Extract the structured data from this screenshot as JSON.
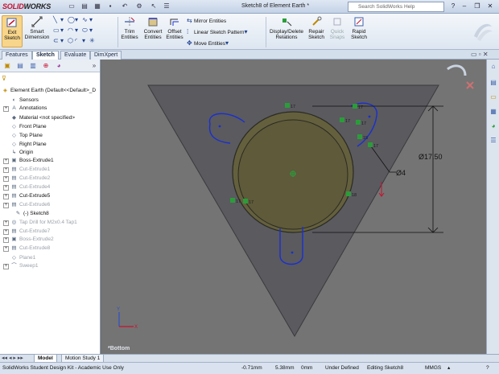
{
  "app": {
    "logo_solid": "SOLID",
    "logo_works": "WORKS",
    "document_title": "Sketch8 of Element Earth *",
    "search_placeholder": "Search SolidWorks Help"
  },
  "ribbon": {
    "exit_sketch": "Exit Sketch",
    "smart_dimension": "Smart Dimension",
    "trim_entities": "Trim Entities",
    "convert_entities": "Convert Entities",
    "offset_entities": "Offset Entities",
    "mirror_entities": "Mirror Entities",
    "linear_sketch_pattern": "Linear Sketch Pattern",
    "move_entities": "Move Entities",
    "display_delete_relations": "Display/Delete Relations",
    "repair_sketch": "Repair Sketch",
    "quick_snaps": "Quick Snaps",
    "rapid_sketch": "Rapid Sketch"
  },
  "tabs": [
    "Features",
    "Sketch",
    "Evaluate",
    "DimXpert"
  ],
  "active_tab": "Sketch",
  "tree": {
    "root": "Element Earth  (Default<<Default>_D",
    "items": [
      {
        "label": "Sensors",
        "icon": "sensor-icon",
        "expandable": false,
        "dim": false
      },
      {
        "label": "Annotations",
        "icon": "annotations-icon",
        "expandable": true,
        "dim": false
      },
      {
        "label": "Material <not specified>",
        "icon": "material-icon",
        "expandable": false,
        "dim": false
      },
      {
        "label": "Front Plane",
        "icon": "plane-icon",
        "expandable": false,
        "dim": false
      },
      {
        "label": "Top Plane",
        "icon": "plane-icon",
        "expandable": false,
        "dim": false
      },
      {
        "label": "Right Plane",
        "icon": "plane-icon",
        "expandable": false,
        "dim": false
      },
      {
        "label": "Origin",
        "icon": "origin-icon",
        "expandable": false,
        "dim": false
      },
      {
        "label": "Boss-Extrude1",
        "icon": "extrude-icon",
        "expandable": true,
        "dim": false
      },
      {
        "label": "Cut-Extrude1",
        "icon": "cut-extrude-icon",
        "expandable": true,
        "dim": true
      },
      {
        "label": "Cut-Extrude2",
        "icon": "cut-extrude-icon",
        "expandable": true,
        "dim": true
      },
      {
        "label": "Cut-Extrude4",
        "icon": "cut-extrude-icon",
        "expandable": true,
        "dim": true
      },
      {
        "label": "Cut-Extrude5",
        "icon": "cut-extrude-icon",
        "expandable": true,
        "dim": false
      },
      {
        "label": "Cut-Extrude6",
        "icon": "cut-extrude-icon",
        "expandable": true,
        "dim": true
      },
      {
        "label": "(-) Sketch8",
        "icon": "sketch-icon",
        "expandable": false,
        "dim": false
      },
      {
        "label": "Tap Drill for M2x0.4 Tap1",
        "icon": "hole-icon",
        "expandable": true,
        "dim": true
      },
      {
        "label": "Cut-Extrude7",
        "icon": "cut-extrude-icon",
        "expandable": true,
        "dim": true
      },
      {
        "label": "Boss-Extrude2",
        "icon": "extrude-icon",
        "expandable": true,
        "dim": true
      },
      {
        "label": "Cut-Extrude8",
        "icon": "cut-extrude-icon",
        "expandable": true,
        "dim": true
      },
      {
        "label": "Plane1",
        "icon": "plane-icon",
        "expandable": false,
        "dim": true
      },
      {
        "label": "Sweep1",
        "icon": "sweep-icon",
        "expandable": true,
        "dim": true
      }
    ]
  },
  "viewport": {
    "view_label": "*Bottom",
    "dim_diameter_large": "Ø17.50",
    "dim_diameter_small": "Ø4",
    "relation_tags": [
      "17",
      "17",
      "17",
      "17",
      "15",
      "17",
      "18",
      "17",
      "17"
    ],
    "colors": {
      "background": "#747474",
      "triangle": "#5a5a5f",
      "disc": "#64603e",
      "sketch_line": "#1a2fd1",
      "relation_tag": "#2b9c3a",
      "dimension_line": "#111111"
    }
  },
  "bottom_tabs": [
    "Model",
    "Motion Study 1"
  ],
  "status": {
    "product": "SolidWorks Student Design Kit - Academic Use Only",
    "x": "-0.71mm",
    "y": "5.38mm",
    "z": "0mm",
    "definition": "Under Defined",
    "editing": "Editing Sketch8",
    "units": "MMGS"
  }
}
